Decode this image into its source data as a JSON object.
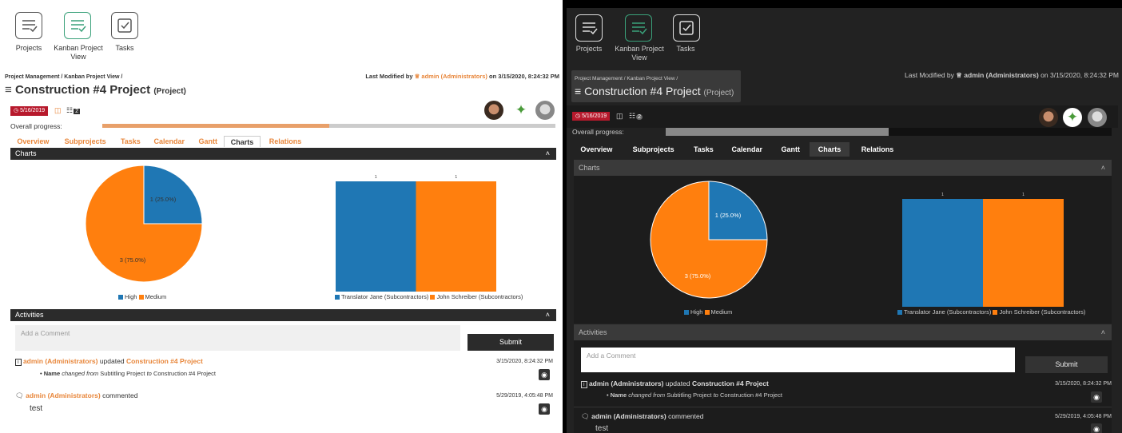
{
  "toolbar": {
    "projects": "Projects",
    "kanban": "Kanban Project View",
    "tasks": "Tasks"
  },
  "breadcrumb": "Project Management / Kanban Project View /",
  "title": "Construction #4 Project",
  "title_type": "(Project)",
  "modified": {
    "prefix": "Last Modified by",
    "user": "admin (Administrators)",
    "suffix": "on 3/15/2020, 8:24:32 PM"
  },
  "date_badge": "5/16/2019",
  "count_badge": "2",
  "progress": {
    "label": "Overall progress:",
    "value": 0.5
  },
  "tabs": [
    "Overview",
    "Subprojects",
    "Tasks",
    "Calendar",
    "Gantt",
    "Charts",
    "Relations"
  ],
  "active_tab": "Charts",
  "charts_header": "Charts",
  "activities_header": "Activities",
  "comment_placeholder": "Add a Comment",
  "submit": "Submit",
  "activity1": {
    "user": "admin (Administrators)",
    "verb": "updated",
    "target": "Construction #4 Project",
    "time": "3/15/2020, 8:24:32 PM",
    "field": "Name",
    "changed": "changed from",
    "from": "Subtitling Project",
    "to_word": "to",
    "to": "Construction #4 Project"
  },
  "activity2": {
    "user": "admin (Administrators)",
    "verb": "commented",
    "time": "5/29/2019, 4:05:48 PM",
    "text": "test"
  },
  "colors": {
    "accent": "#e8863a",
    "blue": "#1f77b4",
    "orange": "#ff7f0e",
    "badge": "#c0392b"
  },
  "chart_data": [
    {
      "type": "pie",
      "labels": [
        "High",
        "Medium"
      ],
      "values": [
        1,
        3
      ],
      "data_labels": [
        "1 (25.0%)",
        "3 (75.0%)"
      ]
    },
    {
      "type": "bar",
      "series": [
        {
          "name": "Translator Jane (Subcontractors)",
          "values": [
            1
          ]
        },
        {
          "name": "John Schreiber (Subcontractors)",
          "values": [
            1
          ]
        }
      ],
      "data_labels": [
        "1",
        "1"
      ]
    }
  ]
}
